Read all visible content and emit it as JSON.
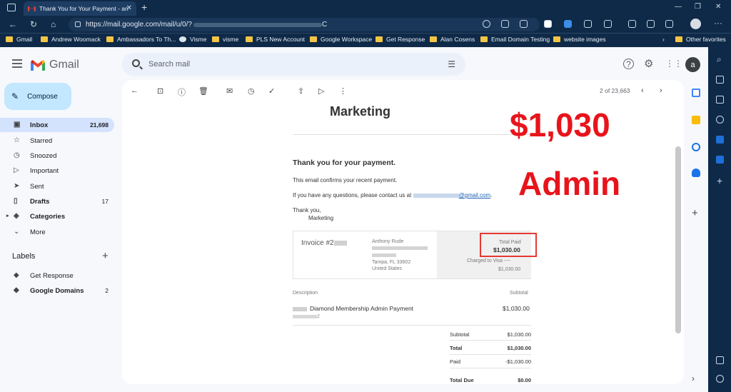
{
  "browser": {
    "tab_title": "Thank You for Your Payment - an",
    "url_prefix": "https://mail.google.com/mail/u/0/?",
    "url_suffix": "C",
    "bookmarks": [
      "Gmail",
      "Andrew Woomack",
      "Ambassadors To Th...",
      "Visme",
      "visme",
      "PLS New Account",
      "Google Workspace",
      "Get Response",
      "Alan Cosens",
      "Email Domain Testing",
      "website images"
    ],
    "other_favorites": "Other favorites"
  },
  "gmail": {
    "logo_text": "Gmail",
    "compose_label": "Compose",
    "search_placeholder": "Search mail",
    "avatar_letter": "a",
    "nav": [
      {
        "label": "Inbox",
        "count": "21,698"
      },
      {
        "label": "Starred",
        "count": ""
      },
      {
        "label": "Snoozed",
        "count": ""
      },
      {
        "label": "Important",
        "count": ""
      },
      {
        "label": "Sent",
        "count": ""
      },
      {
        "label": "Drafts",
        "count": "17"
      },
      {
        "label": "Categories",
        "count": ""
      },
      {
        "label": "More",
        "count": ""
      }
    ],
    "labels_heading": "Labels",
    "labels": [
      {
        "label": "Get Response",
        "count": ""
      },
      {
        "label": "Google Domains",
        "count": "2"
      }
    ],
    "pager": "2 of 23,663"
  },
  "email": {
    "brand": "Marketing",
    "heading": "Thank you for your payment.",
    "line1": "This email confirms your recent payment.",
    "line2_prefix": "If you have any questions, please contact us at",
    "line2_email": "@gmail.com",
    "line2_suffix": ".",
    "signoff": "Thank you,",
    "signoff_name": "Marketing",
    "invoice_label": "Invoice #2",
    "billing_name": "Anthony Rude",
    "billing_city": "Tampa, FL 33602",
    "billing_country": "United States",
    "total_paid_label": "Total Paid",
    "total_paid_value": "$1,030.00",
    "charged_label": "Charged to Visa ----",
    "charged_value": "$1,030.00",
    "description_header": "Description",
    "subtotal_header": "Subtotal",
    "item_name": "Diamond Membership Admin Payment",
    "item_sub": "2",
    "item_amount": "$1,030.00",
    "summary": [
      {
        "k": "Subtotal",
        "v": "$1,030.00"
      },
      {
        "k": "Total",
        "v": "$1,030.00"
      },
      {
        "k": "Paid",
        "v": "-$1,030.00"
      },
      {
        "k": "Total Due",
        "v": "$0.00"
      }
    ]
  },
  "overlay": {
    "amount": "$1,030",
    "role": "Admin",
    "color": "#e8141b"
  }
}
